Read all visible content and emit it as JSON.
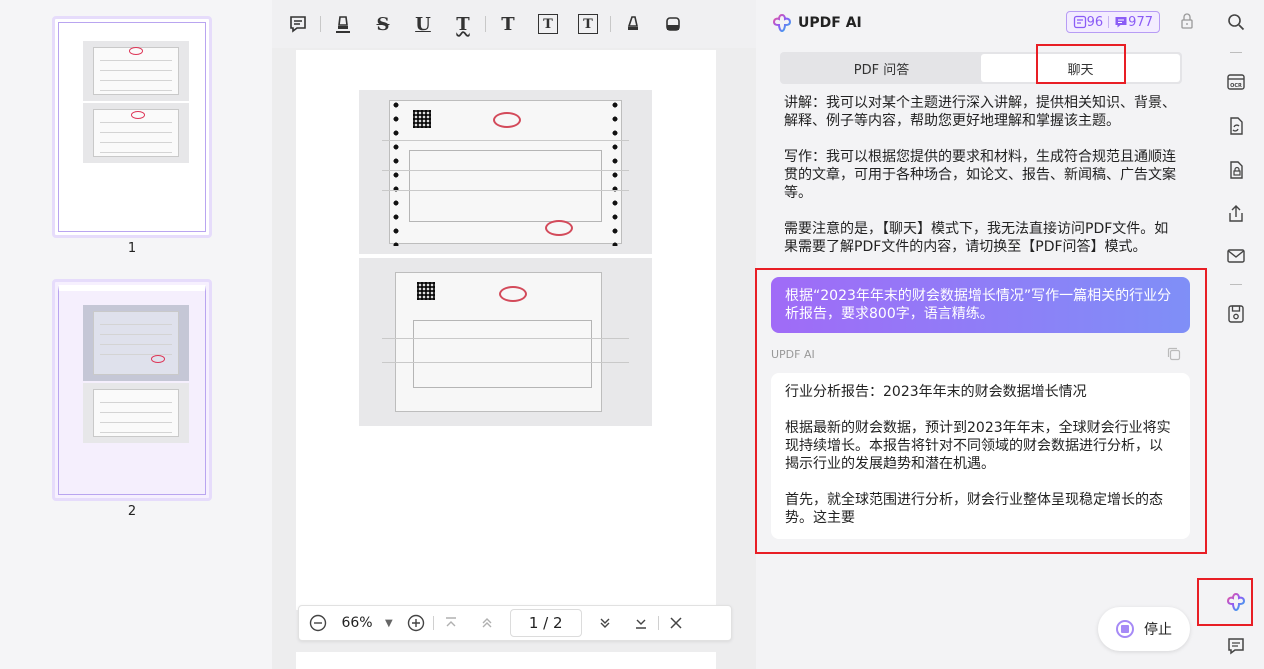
{
  "thumbnails": [
    {
      "page_number": "1"
    },
    {
      "page_number": "2"
    }
  ],
  "toolbar": {
    "tools": [
      {
        "name": "comment-icon"
      },
      {
        "name": "highlight-icon"
      },
      {
        "name": "strikethrough-icon",
        "glyph": "S"
      },
      {
        "name": "underline-icon",
        "glyph": "U"
      },
      {
        "name": "squiggly-underline-icon",
        "glyph": "T"
      },
      {
        "name": "text-icon",
        "glyph": "T"
      },
      {
        "name": "textbox-icon",
        "glyph": "T"
      },
      {
        "name": "text-callout-icon",
        "glyph": "T"
      },
      {
        "name": "pencil-icon"
      },
      {
        "name": "eraser-icon"
      }
    ]
  },
  "zoombar": {
    "zoom_level": "66%",
    "page_indicator": "1 / 2"
  },
  "ai_panel": {
    "title": "UPDF AI",
    "quota_pdf": "96",
    "quota_chat": "977",
    "tabs": [
      {
        "label": "PDF 问答",
        "active": false
      },
      {
        "label": "聊天",
        "active": true
      }
    ],
    "prior_response": [
      "讲解：我可以对某个主题进行深入讲解，提供相关知识、背景、解释、例子等内容，帮助您更好地理解和掌握该主题。",
      "写作：我可以根据您提供的要求和材料，生成符合规范且通顺连贯的文章，可用于各种场合，如论文、报告、新闻稿、广告文案等。",
      "需要注意的是，【聊天】模式下，我无法直接访问PDF文件。如果需要了解PDF文件的内容，请切换至【PDF问答】模式。"
    ],
    "user_message": "根据“2023年年末的财会数据增长情况”写作一篇相关的行业分析报告，要求800字，语言精练。",
    "ai_label": "UPDF AI",
    "ai_response": [
      "行业分析报告：2023年年末的财会数据增长情况",
      "根据最新的财会数据，预计到2023年年末，全球财会行业将实现持续增长。本报告将针对不同领域的财会数据进行分析，以揭示行业的发展趋势和潜在机遇。",
      "首先，就全球范围进行分析，财会行业整体呈现稳定增长的态势。这主要"
    ],
    "stop_label": "停止"
  },
  "colors": {
    "accent": "#8b5cf6",
    "highlight_box": "#e81e25",
    "bubble_gradient_start": "#a06bf7",
    "bubble_gradient_end": "#7f8ff7"
  },
  "rail": {
    "icons": [
      "search-icon",
      "ocr-icon",
      "convert-icon",
      "protect-icon",
      "share-icon",
      "mail-icon",
      "save-icon",
      "updf-ai-icon",
      "comments-list-icon"
    ]
  }
}
